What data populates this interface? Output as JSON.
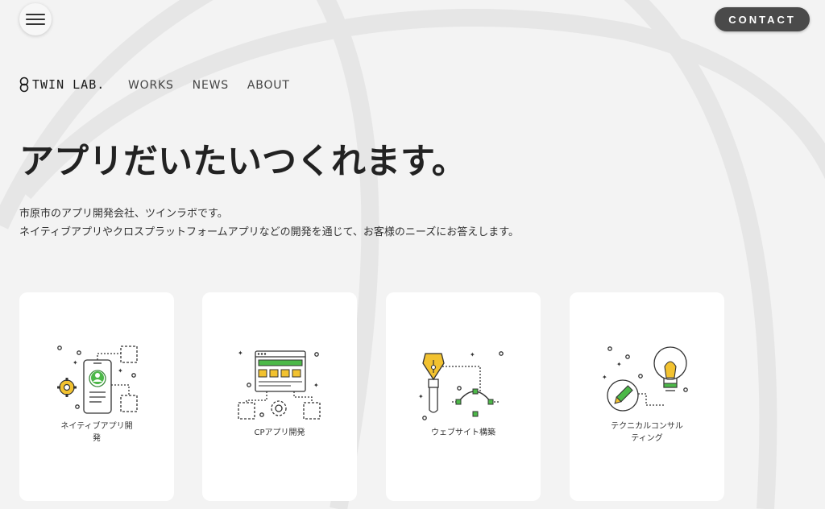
{
  "header": {
    "contact_label": "CONTACT",
    "logo_text": "TWIN LAB."
  },
  "nav": {
    "items": [
      "WORKS",
      "NEWS",
      "ABOUT"
    ]
  },
  "hero": {
    "headline": "アプリだいたいつくれます。",
    "lead_line1": "市原市のアプリ開発会社、ツインラボです。",
    "lead_line2": "ネイティブアプリやクロスプラットフォームアプリなどの開発を通じて、お客様のニーズにお答えします。"
  },
  "services": [
    {
      "line1": "ネイティブアプリ開",
      "line2": "発",
      "icon": "smartphone-icon"
    },
    {
      "line1": "CPアプリ開発",
      "line2": "",
      "icon": "browser-window-icon"
    },
    {
      "line1": "ウェブサイト構築",
      "line2": "",
      "icon": "pen-tool-icon"
    },
    {
      "line1": "テクニカルコンサル",
      "line2": "ティング",
      "icon": "lightbulb-icon"
    }
  ],
  "colors": {
    "background": "#f3f3f3",
    "contact_button": "#4a4a4a",
    "accent_yellow": "#f2c230",
    "accent_green": "#4cb848",
    "card_background": "#ffffff"
  }
}
